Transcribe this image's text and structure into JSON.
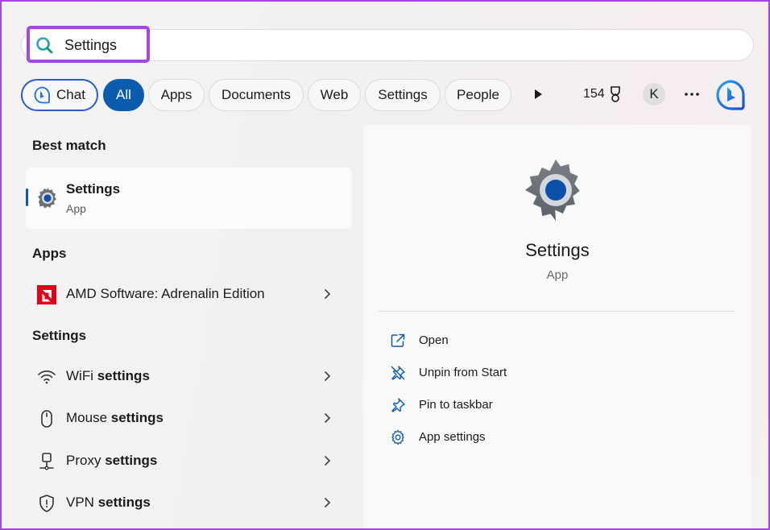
{
  "search": {
    "value": "Settings"
  },
  "filters": {
    "chat": "Chat",
    "all": "All",
    "apps": "Apps",
    "documents": "Documents",
    "web": "Web",
    "settings": "Settings",
    "people": "People",
    "points": "154",
    "avatar_initial": "K"
  },
  "best_match": {
    "heading": "Best match",
    "title": "Settings",
    "subtitle": "App"
  },
  "apps_section": {
    "heading": "Apps",
    "items": [
      {
        "label": "AMD Software: Adrenalin Edition",
        "icon": "amd-logo-icon"
      }
    ]
  },
  "settings_section": {
    "heading": "Settings",
    "items": [
      {
        "pre": "WiFi ",
        "bold": "settings",
        "icon": "wifi-icon"
      },
      {
        "pre": "Mouse ",
        "bold": "settings",
        "icon": "mouse-icon"
      },
      {
        "pre": "Proxy ",
        "bold": "settings",
        "icon": "proxy-icon"
      },
      {
        "pre": "VPN ",
        "bold": "settings",
        "icon": "shield-icon"
      }
    ]
  },
  "detail": {
    "title": "Settings",
    "subtitle": "App",
    "actions": [
      {
        "label": "Open",
        "icon": "open-external-icon"
      },
      {
        "label": "Unpin from Start",
        "icon": "unpin-icon"
      },
      {
        "label": "Pin to taskbar",
        "icon": "pin-icon"
      },
      {
        "label": "App settings",
        "icon": "gear-icon"
      }
    ]
  },
  "colors": {
    "accent": "#0b5cad",
    "highlight": "#a646e0",
    "amd_red": "#e0001b"
  }
}
